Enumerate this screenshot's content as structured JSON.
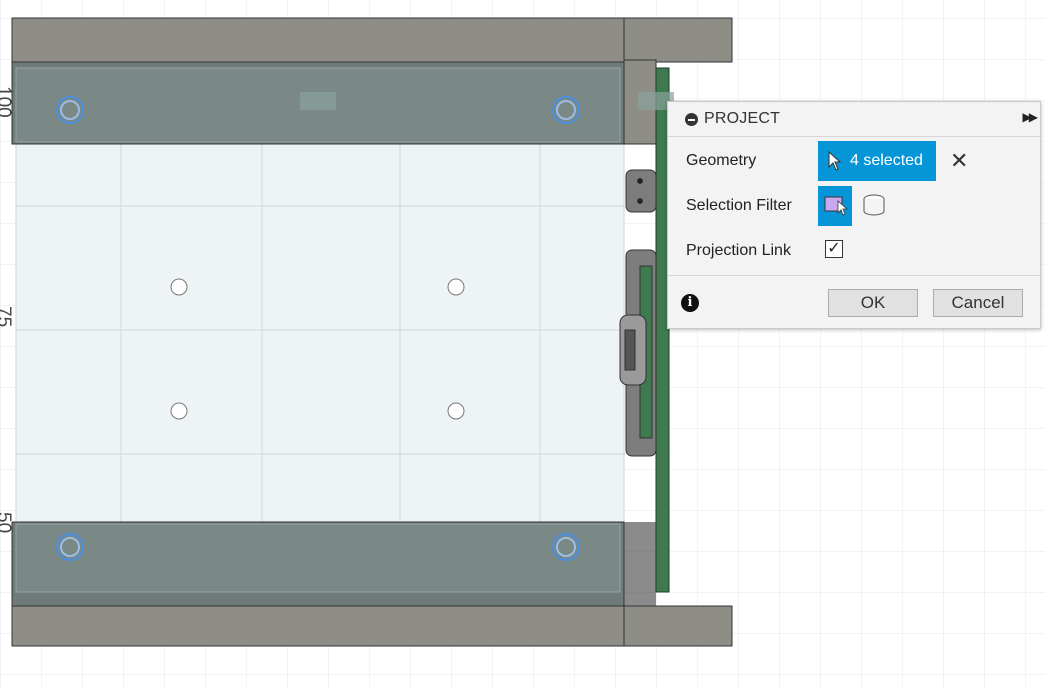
{
  "viewport": {
    "ruler_labels": [
      "100",
      "75",
      "50"
    ]
  },
  "panel": {
    "title": "PROJECT",
    "geometry_label": "Geometry",
    "geometry_value": "4 selected",
    "clear_symbol": "✕",
    "selection_filter_label": "Selection Filter",
    "projection_link_label": "Projection Link",
    "projection_link_checked": true,
    "check_mark": "✓",
    "info_symbol": "i",
    "ok_label": "OK",
    "cancel_label": "Cancel",
    "colors": {
      "accent": "#0696d7",
      "selection_highlight": "#4a90e2",
      "body_gray": "#8e8d86",
      "pcb_green": "#3f7a4f"
    }
  }
}
